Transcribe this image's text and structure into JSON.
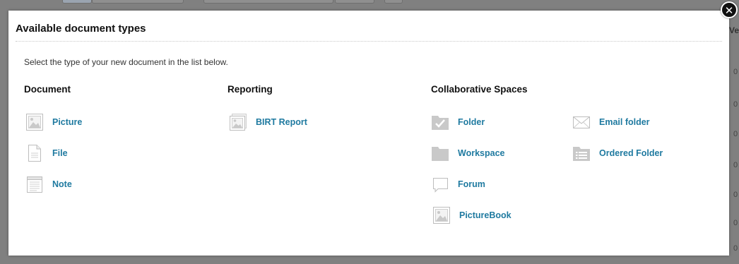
{
  "modal": {
    "title": "Available document types",
    "intro": "Select the type of your new document in the list below.",
    "close_icon": "close-icon"
  },
  "columns": {
    "document": {
      "heading": "Document",
      "items": [
        {
          "label": "Picture",
          "icon": "picture-icon"
        },
        {
          "label": "File",
          "icon": "file-icon"
        },
        {
          "label": "Note",
          "icon": "note-icon"
        }
      ]
    },
    "reporting": {
      "heading": "Reporting",
      "items": [
        {
          "label": "BIRT Report",
          "icon": "birt-report-icon"
        }
      ]
    },
    "collaborative": {
      "heading": "Collaborative Spaces",
      "items": [
        {
          "label": "Folder",
          "icon": "folder-icon"
        },
        {
          "label": "Workspace",
          "icon": "workspace-icon"
        },
        {
          "label": "Forum",
          "icon": "forum-icon"
        },
        {
          "label": "PictureBook",
          "icon": "picturebook-icon"
        },
        {
          "label": "Email folder",
          "icon": "email-folder-icon"
        },
        {
          "label": "Ordered Folder",
          "icon": "ordered-folder-icon"
        }
      ]
    }
  },
  "background": {
    "column_header_fragment": "Ve",
    "row_digits": [
      "0",
      "0",
      "0",
      "0",
      "0",
      "0",
      "0"
    ]
  },
  "colors": {
    "link": "#1f7aa0",
    "overlay": "#808080",
    "icon_gray": "#c9c9c9"
  }
}
